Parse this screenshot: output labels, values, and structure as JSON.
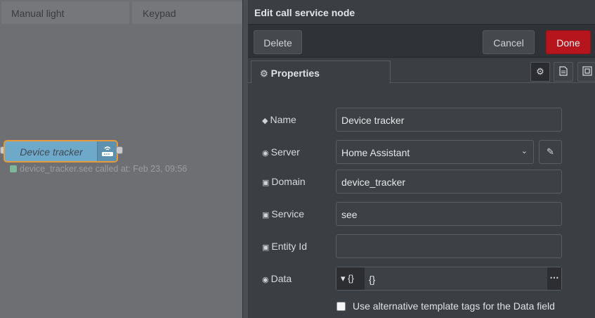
{
  "workspace": {
    "tabs": [
      "Manual light",
      "Keypad"
    ],
    "node": {
      "label": "Device tracker",
      "icon": "router-icon"
    },
    "status": {
      "text": "device_tracker.see called at: Feb 23, 09:56",
      "color": "#7eb89b"
    }
  },
  "editor": {
    "title": "Edit call service node",
    "buttons": {
      "delete": "Delete",
      "cancel": "Cancel",
      "done": "Done"
    },
    "tab": "Properties",
    "fields": {
      "name": {
        "label": "Name",
        "value": "Device tracker"
      },
      "server": {
        "label": "Server",
        "value": "Home Assistant"
      },
      "domain": {
        "label": "Domain",
        "value": "device_tracker"
      },
      "service": {
        "label": "Service",
        "value": "see"
      },
      "entity_id": {
        "label": "Entity Id",
        "value": ""
      },
      "data": {
        "label": "Data",
        "type": "{}",
        "value": "{}"
      }
    },
    "alt_template_label": "Use alternative template tags for the Data field",
    "alt_template_checked": false
  },
  "colors": {
    "done": "#b7151d",
    "node": "#6fa9c9",
    "node_border": "#e89a3b"
  }
}
